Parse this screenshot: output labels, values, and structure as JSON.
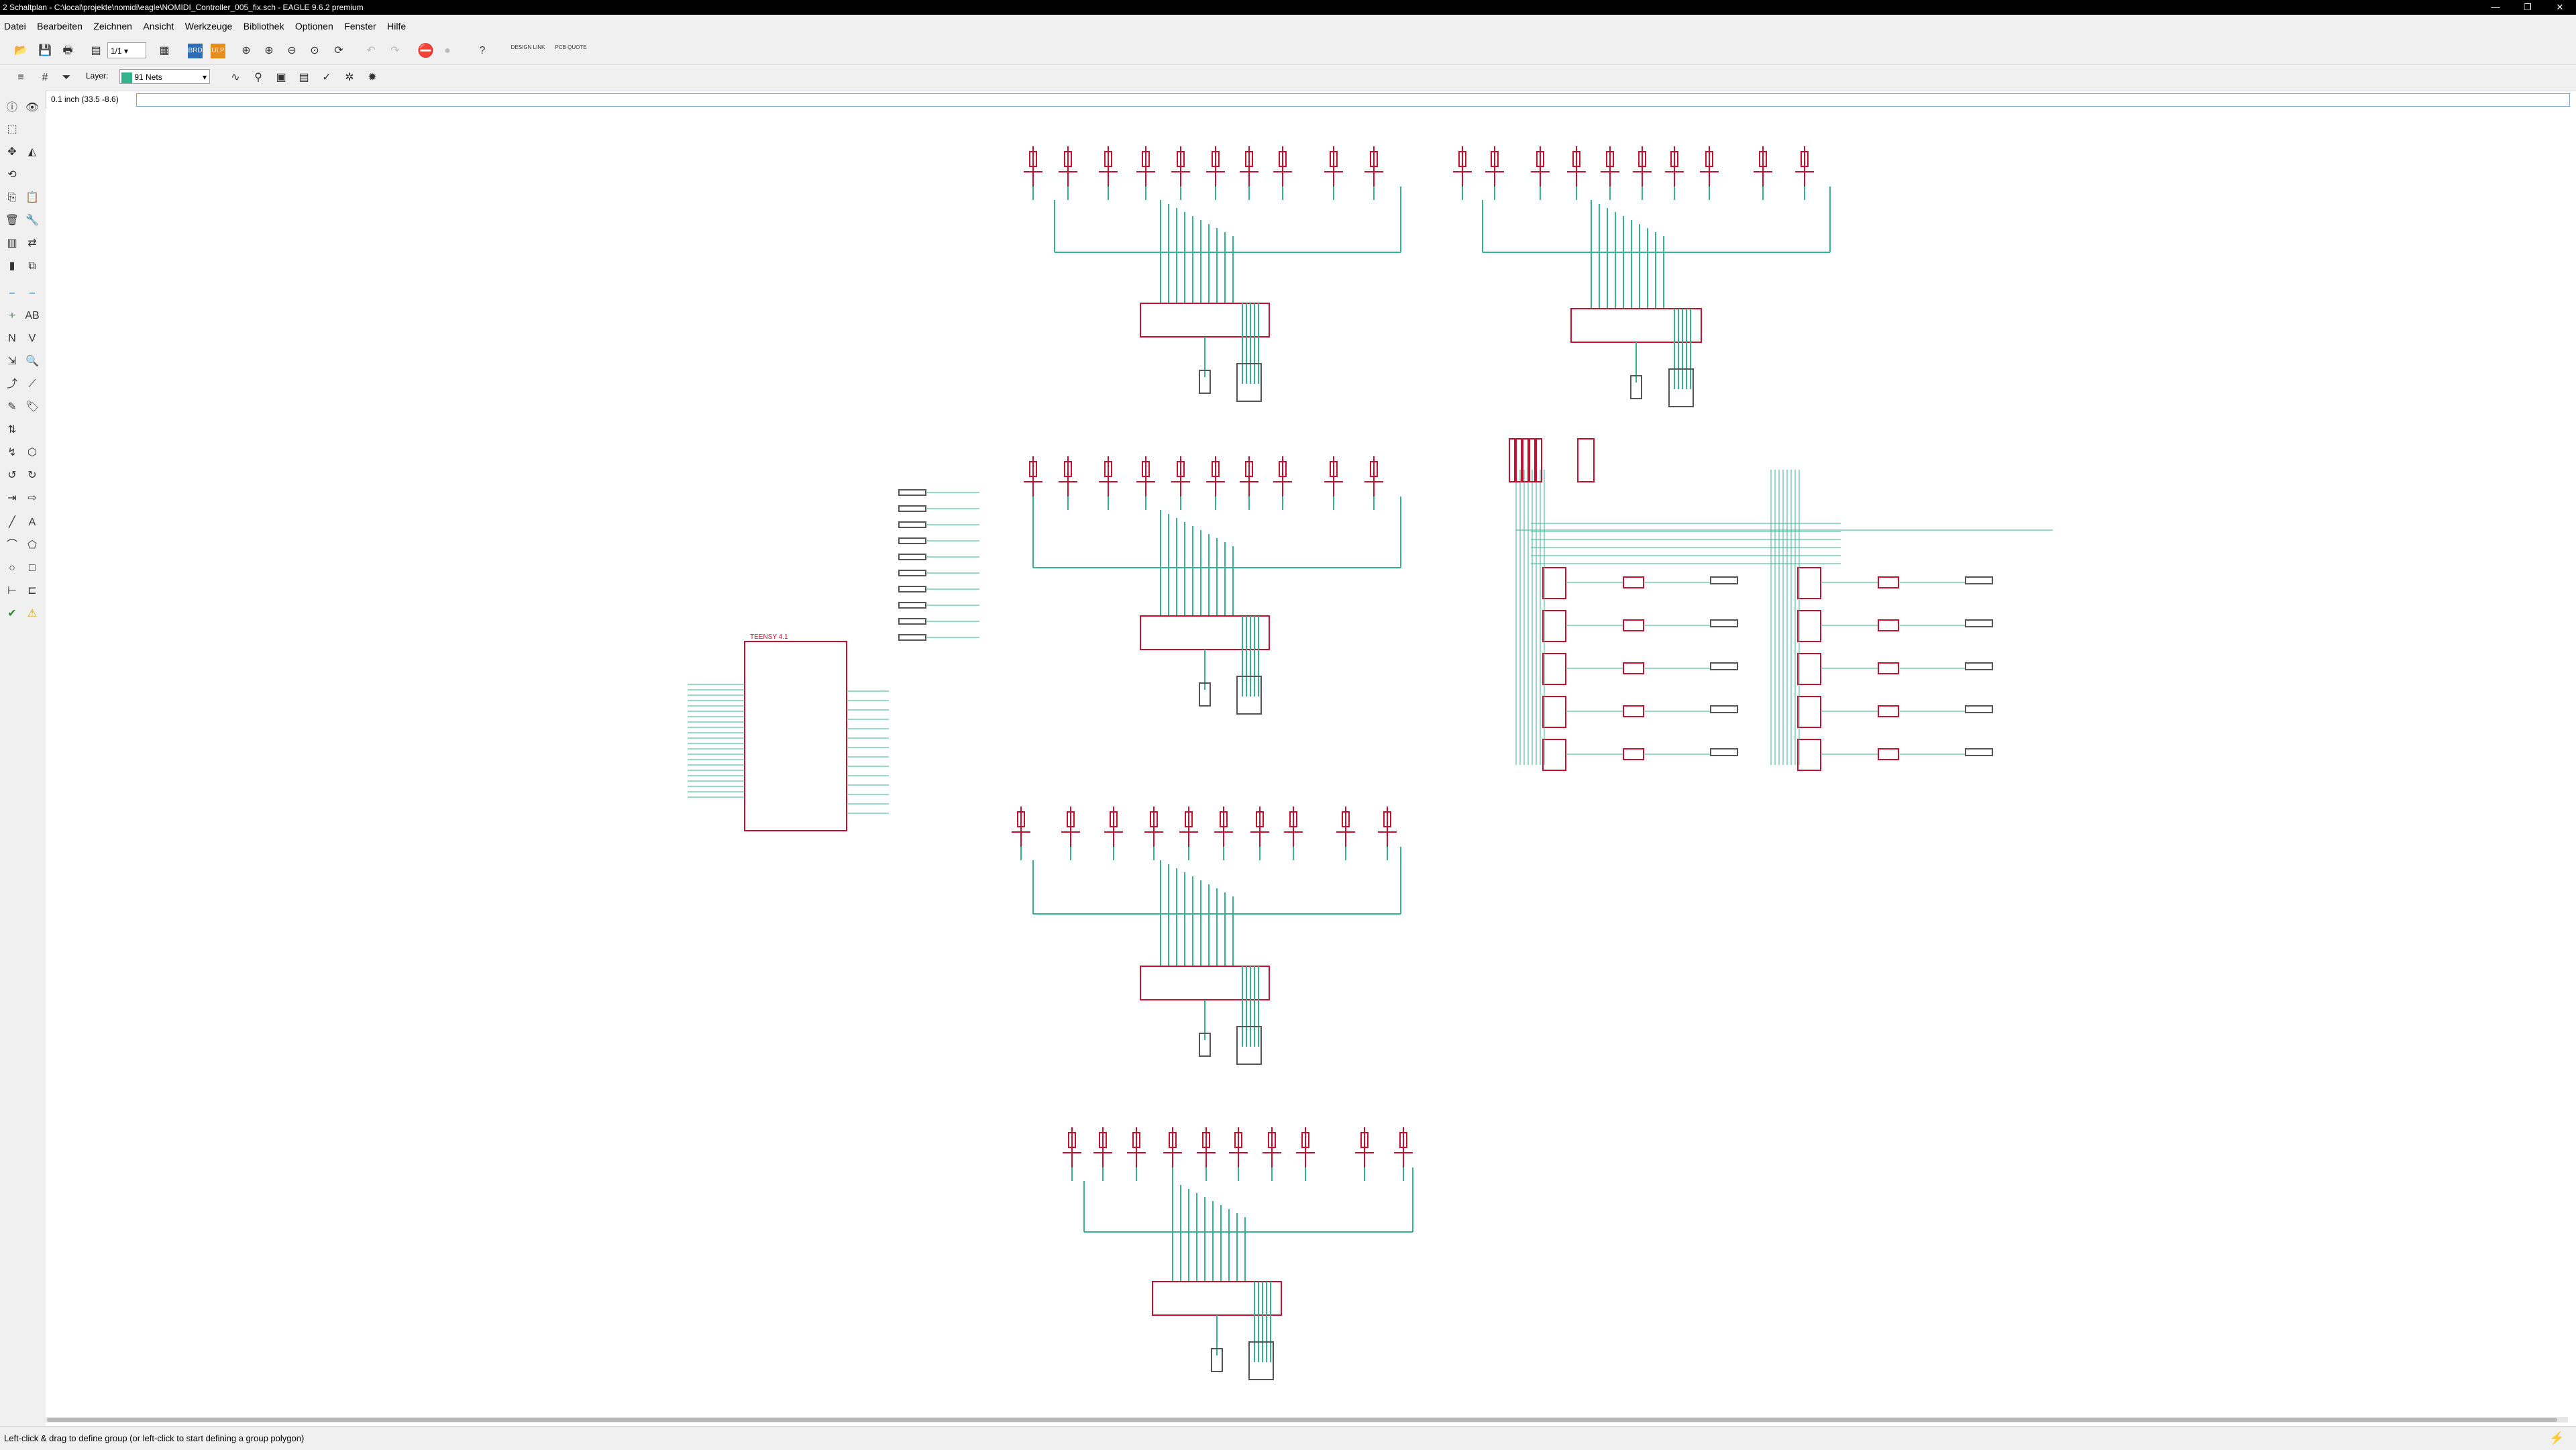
{
  "window": {
    "title": "2 Schaltplan - C:\\local\\projekte\\nomidi\\eagle\\NOMIDI_Controller_005_fix.sch - EAGLE 9.6.2 premium",
    "controls": [
      "—",
      "❐",
      "✕"
    ]
  },
  "menu": [
    "Datei",
    "Bearbeiten",
    "Zeichnen",
    "Ansicht",
    "Werkzeuge",
    "Bibliothek",
    "Optionen",
    "Fenster",
    "Hilfe"
  ],
  "toolbar": {
    "sheet_select": "1/1",
    "design_link_label": "DESIGN LINK",
    "pcb_quote_label": "PCB QUOTE"
  },
  "toolbar2": {
    "layer_label": "Layer:",
    "layer_value": "91 Nets",
    "layer_color": "#35b38e"
  },
  "command": {
    "coords": "0.1 inch (33.5 -8.6)",
    "value": ""
  },
  "status": {
    "message": "Left-click & drag to define group (or left-click to start defining a group polygon)"
  },
  "schematic": {
    "wire_color": "#35b38e",
    "symbol_color": "#c8102e",
    "mcu_label": "TEENSY 4.1"
  }
}
